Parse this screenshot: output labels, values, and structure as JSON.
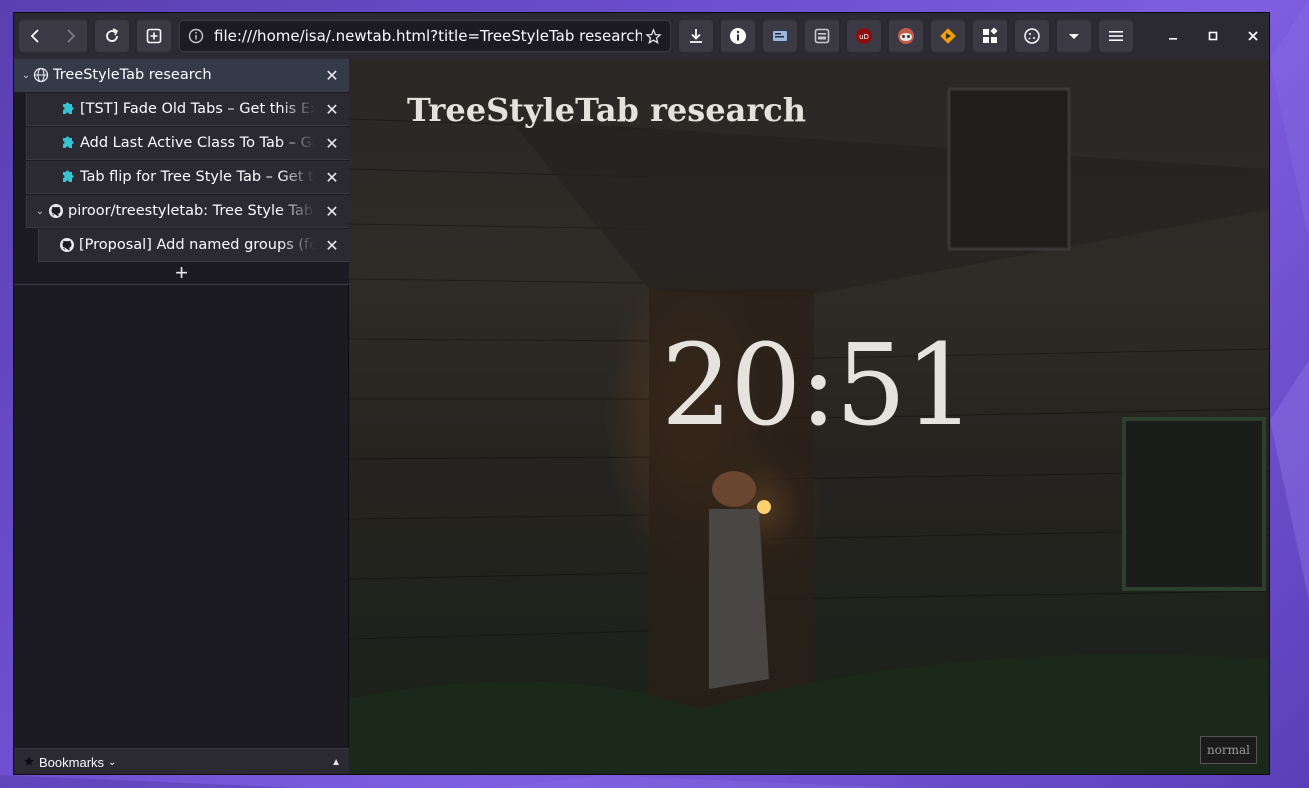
{
  "toolbar": {
    "url": "file:///home/isa/.newtab.html?title=TreeStyleTab research",
    "extensions": [
      {
        "name": "info-extension-icon",
        "color": "#fbfbfe"
      },
      {
        "name": "readerview-extension-icon",
        "color": "#9bb7e0"
      },
      {
        "name": "container-extension-icon",
        "color": "#c9c8cf"
      },
      {
        "name": "ublock-origin-icon",
        "color": "#8b0f0f"
      },
      {
        "name": "privacy-badger-icon",
        "color": "#c85a4a"
      },
      {
        "name": "sponsorblock-icon",
        "color": "#f0a000"
      },
      {
        "name": "apps-grid-icon",
        "color": "#fbfbfe"
      },
      {
        "name": "cookie-icon",
        "color": "#fbfbfe"
      }
    ]
  },
  "sidebar": {
    "tabs": [
      {
        "title": "TreeStyleTab research",
        "favicon": "globe-icon",
        "expanded": true
      },
      {
        "title": "[TST] Fade Old Tabs – Get this Extension for Firefox",
        "favicon": "puzzle-icon"
      },
      {
        "title": "Add Last Active Class To Tab – Get this Extension",
        "favicon": "puzzle-icon"
      },
      {
        "title": "Tab flip for Tree Style Tab – Get this Extension",
        "favicon": "puzzle-icon"
      },
      {
        "title": "piroor/treestyletab: Tree Style Tab, Show tabs like a tree.",
        "favicon": "github-icon",
        "expanded": true
      },
      {
        "title": "[Proposal] Add named groups (folders)",
        "favicon": "github-icon"
      }
    ],
    "new_tab_symbol": "+",
    "bookmarks_label": "Bookmarks"
  },
  "page": {
    "heading": "TreeStyleTab research",
    "clock": "20:51",
    "mode": "normal"
  },
  "colors": {
    "toolbar_bg": "#2b2a33",
    "sidebar_bg": "#1c1b22",
    "active_tab_bg": "#343a48",
    "desktop": "#6d4fd0"
  }
}
